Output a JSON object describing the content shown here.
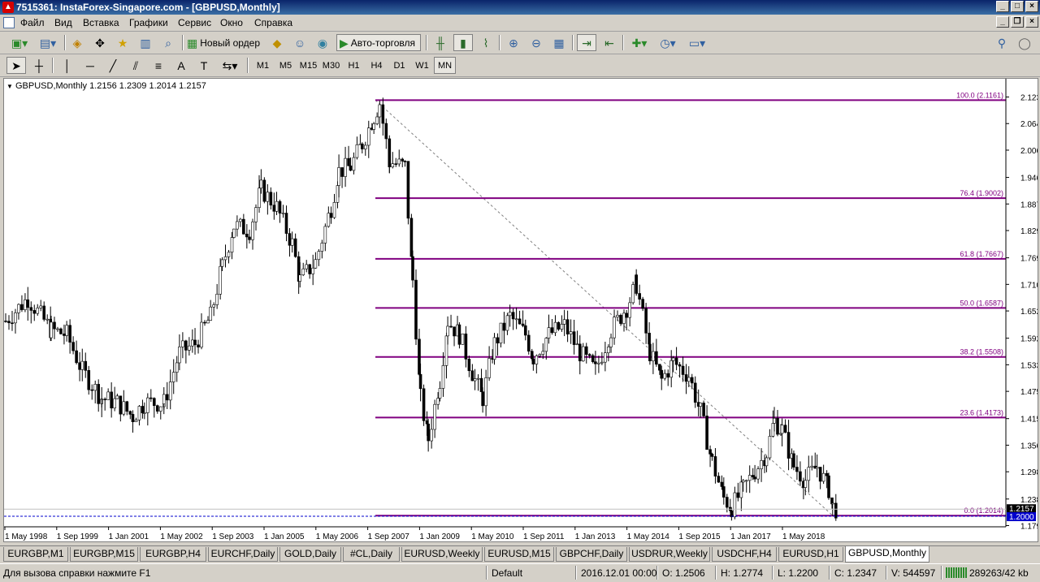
{
  "window": {
    "title": "7515361: InstaForex-Singapore.com - [GBPUSD,Monthly]"
  },
  "menu": [
    "Файл",
    "Вид",
    "Вставка",
    "Графики",
    "Сервис",
    "Окно",
    "Справка"
  ],
  "toolbar": {
    "new_order": "Новый ордер",
    "auto_trading": "Авто-торговля"
  },
  "timeframes": [
    "M1",
    "M5",
    "M15",
    "M30",
    "H1",
    "H4",
    "D1",
    "W1",
    "MN"
  ],
  "active_timeframe": "MN",
  "chart": {
    "header": "GBPUSD,Monthly  1.2156 1.2309 1.2014 1.2157",
    "current_price": "1.2157",
    "bid_line": "1.2000"
  },
  "chart_data": {
    "type": "candlestick",
    "symbol": "GBPUSD",
    "timeframe": "Monthly",
    "ohlc": {
      "open": 1.2156,
      "high": 1.2309,
      "low": 1.2014,
      "close": 1.2157
    },
    "y_ticks": [
      "2.1230",
      "2.0645",
      "2.0060",
      "1.9460",
      "1.8875",
      "1.8290",
      "1.7690",
      "1.7105",
      "1.6520",
      "1.5920",
      "1.5335",
      "1.4750",
      "1.4150",
      "1.3565",
      "1.2980",
      "1.2380",
      "1.1795"
    ],
    "x_ticks": [
      "1 May 1998",
      "1 Sep 1999",
      "1 Jan 2001",
      "1 May 2002",
      "1 Sep 2003",
      "1 Jan 2005",
      "1 May 2006",
      "1 Sep 2007",
      "1 Jan 2009",
      "1 May 2010",
      "1 Sep 2011",
      "1 Jan 2013",
      "1 May 2014",
      "1 Sep 2015",
      "1 Jan 2017",
      "1 May 2018"
    ],
    "ylim": [
      1.1795,
      2.123
    ],
    "fibonacci": [
      {
        "label": "100.0 (2.1161)",
        "price": 2.1161
      },
      {
        "label": "76.4 (1.9002)",
        "price": 1.9002
      },
      {
        "label": "61.8 (1.7667)",
        "price": 1.7667
      },
      {
        "label": "50.0 (1.6587)",
        "price": 1.6587
      },
      {
        "label": "38.2 (1.5508)",
        "price": 1.5508
      },
      {
        "label": "23.6 (1.4173)",
        "price": 1.4173
      },
      {
        "label": "0.0 (1.2014)",
        "price": 1.2014
      }
    ],
    "price_path": [
      [
        1998.33,
        1.63
      ],
      [
        1998.9,
        1.68
      ],
      [
        1999.5,
        1.61
      ],
      [
        1999.9,
        1.6
      ],
      [
        2000.3,
        1.52
      ],
      [
        2000.8,
        1.46
      ],
      [
        2001.2,
        1.45
      ],
      [
        2001.6,
        1.42
      ],
      [
        2001.9,
        1.45
      ],
      [
        2002.4,
        1.45
      ],
      [
        2002.8,
        1.56
      ],
      [
        2003.2,
        1.58
      ],
      [
        2003.6,
        1.64
      ],
      [
        2003.9,
        1.75
      ],
      [
        2004.2,
        1.84
      ],
      [
        2004.6,
        1.83
      ],
      [
        2004.9,
        1.92
      ],
      [
        2005.3,
        1.88
      ],
      [
        2005.7,
        1.8
      ],
      [
        2005.9,
        1.72
      ],
      [
        2006.3,
        1.76
      ],
      [
        2006.7,
        1.88
      ],
      [
        2006.9,
        1.96
      ],
      [
        2007.2,
        1.97
      ],
      [
        2007.5,
        2.02
      ],
      [
        2007.8,
        2.08
      ],
      [
        2007.95,
        2.11
      ],
      [
        2008.2,
        1.98
      ],
      [
        2008.6,
        1.97
      ],
      [
        2008.8,
        1.72
      ],
      [
        2009.0,
        1.46
      ],
      [
        2009.2,
        1.37
      ],
      [
        2009.5,
        1.5
      ],
      [
        2009.7,
        1.63
      ],
      [
        2010.0,
        1.6
      ],
      [
        2010.4,
        1.5
      ],
      [
        2010.6,
        1.46
      ],
      [
        2010.9,
        1.58
      ],
      [
        2011.3,
        1.64
      ],
      [
        2011.7,
        1.6
      ],
      [
        2011.9,
        1.55
      ],
      [
        2012.3,
        1.6
      ],
      [
        2012.7,
        1.62
      ],
      [
        2013.1,
        1.56
      ],
      [
        2013.5,
        1.52
      ],
      [
        2013.9,
        1.61
      ],
      [
        2014.3,
        1.66
      ],
      [
        2014.55,
        1.71
      ],
      [
        2014.9,
        1.56
      ],
      [
        2015.2,
        1.5
      ],
      [
        2015.5,
        1.54
      ],
      [
        2015.9,
        1.51
      ],
      [
        2016.2,
        1.43
      ],
      [
        2016.5,
        1.32
      ],
      [
        2016.8,
        1.24
      ],
      [
        2017.0,
        1.22
      ],
      [
        2017.3,
        1.26
      ],
      [
        2017.6,
        1.3
      ],
      [
        2017.9,
        1.34
      ],
      [
        2018.1,
        1.41
      ],
      [
        2018.3,
        1.39
      ],
      [
        2018.6,
        1.31
      ],
      [
        2018.9,
        1.28
      ],
      [
        2019.2,
        1.31
      ],
      [
        2019.5,
        1.26
      ],
      [
        2019.6,
        1.22
      ],
      [
        2019.7,
        1.2157
      ]
    ]
  },
  "tabs": [
    "EURGBP,M1",
    "EURGBP,M15",
    "EURGBP,H4",
    "EURCHF,Daily",
    "GOLD,Daily",
    "#CL,Daily",
    "EURUSD,Weekly",
    "EURUSD,M15",
    "GBPCHF,Daily",
    "USDRUR,Weekly",
    "USDCHF,H4",
    "EURUSD,H1",
    "GBPUSD,Monthly"
  ],
  "active_tab": "GBPUSD,Monthly",
  "status": {
    "help": "Для вызова справки нажмите F1",
    "profile": "Default",
    "datetime": "2016.12.01 00:00",
    "open": "O: 1.2506",
    "high": "H: 1.2774",
    "low": "L: 1.2200",
    "close": "C: 1.2347",
    "volume": "V: 544597",
    "traffic": "289263/42 kb"
  },
  "colors": {
    "fib": "#800080",
    "accent": "#0a246a",
    "bid": "#0000cc"
  }
}
